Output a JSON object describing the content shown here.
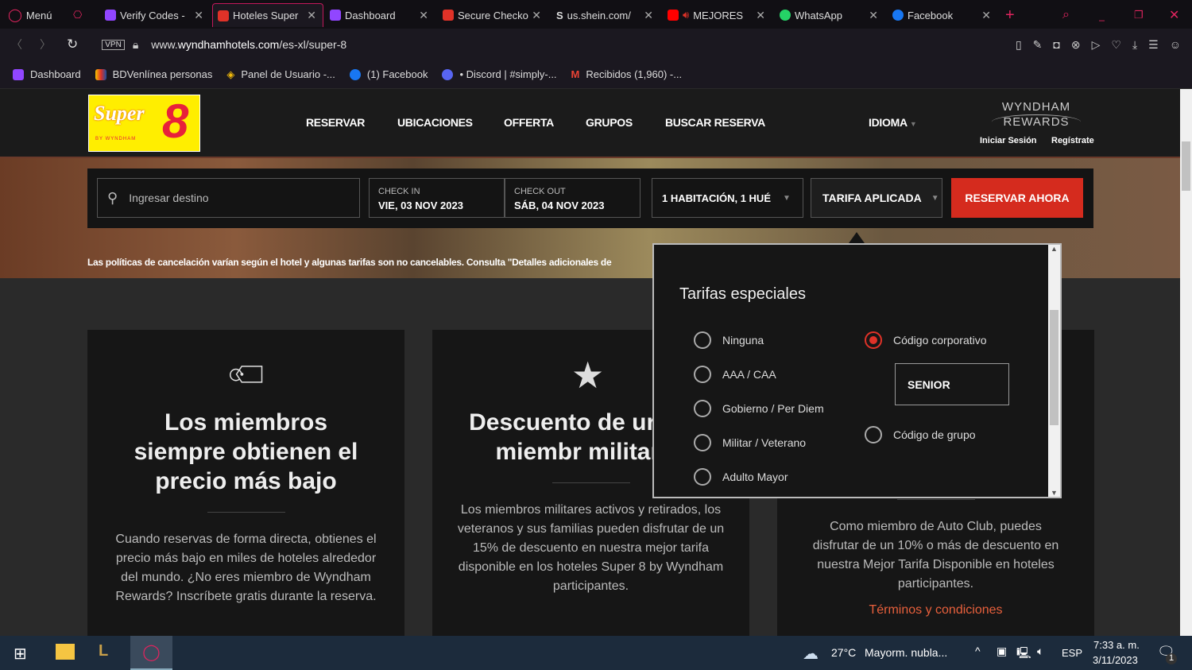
{
  "browser": {
    "menu_label": "Menú",
    "tabs": [
      {
        "label": "Verify Codes -",
        "icon": "twitch-icon"
      },
      {
        "label": "Hoteles Super",
        "icon": "super8-icon",
        "active": true
      },
      {
        "label": "Dashboard",
        "icon": "twitch-icon"
      },
      {
        "label": "Secure Checko",
        "icon": "checkout-icon"
      },
      {
        "label": "us.shein.com/",
        "icon": "shein-icon"
      },
      {
        "label": "MEJORES",
        "icon": "youtube-icon"
      },
      {
        "label": "WhatsApp",
        "icon": "whatsapp-icon"
      },
      {
        "label": "Facebook",
        "icon": "facebook-icon"
      }
    ],
    "vpn_label": "VPN",
    "url_prefix": "www.",
    "url_domain": "wyndhamhotels.com",
    "url_path": "/es-xl/super-8",
    "bookmarks": [
      {
        "label": "Dashboard",
        "icon": "twitch-icon"
      },
      {
        "label": "BDVenlínea personas",
        "icon": "bdv-icon"
      },
      {
        "label": "Panel de Usuario -...",
        "icon": "binance-icon"
      },
      {
        "label": "(1) Facebook",
        "icon": "facebook-icon"
      },
      {
        "label": "• Discord | #simply-...",
        "icon": "discord-icon"
      },
      {
        "label": "Recibidos (1,960) -...",
        "icon": "gmail-icon"
      }
    ]
  },
  "site": {
    "logo_text": "Super 8",
    "logo_sub": "BY WYNDHAM",
    "nav": [
      "RESERVAR",
      "UBICACIONES",
      "OFFERTA",
      "GRUPOS",
      "BUSCAR RESERVA"
    ],
    "language": "IDIOMA",
    "rewards_line1": "WYNDHAM",
    "rewards_line2": "REWARDS",
    "sign_in": "Iniciar Sesión",
    "register": "Regístrate",
    "booking": {
      "destination_placeholder": "Ingresar destino",
      "checkin_label": "CHECK IN",
      "checkin_value": "VIE, 03 NOV 2023",
      "checkout_label": "CHECK OUT",
      "checkout_value": "SÁB, 04 NOV 2023",
      "rooms": "1 HABITACIÓN, 1 HUÉ",
      "rate": "TARIFA APLICADA",
      "book_now": "RESERVAR AHORA"
    },
    "cancel_notice": "Las políticas de cancelación varían según el hotel y algunas tarifas son no cancelables. Consulta \"Detalles adicionales de",
    "rates_popup": {
      "title": "Tarifas especiales",
      "options_left": [
        "Ninguna",
        "AAA / CAA",
        "Gobierno / Per Diem",
        "Militar / Veterano",
        "Adulto Mayor"
      ],
      "corporate": "Código corporativo",
      "corporate_code": "SENIOR",
      "group": "Código de grupo",
      "selected": "Código corporativo"
    },
    "cards": [
      {
        "title": "Los miembros siempre obtienen el precio más bajo",
        "body": "Cuando reservas de forma directa, obtienes el precio más bajo en miles de hoteles alrededor del mundo. ¿No eres miembro de Wyndham Rewards? Inscríbete gratis durante la reserva.",
        "icon": "tag-icon"
      },
      {
        "title": "Descuento de ur para miembr militares",
        "body": "Los miembros militares activos y retirados, los veteranos y sus familias pueden disfrutar de un 15% de descuento en nuestra mejor tarifa disponible en los hoteles Super 8 by Wyndham participantes.",
        "icon": "star-icon"
      },
      {
        "body": "Como miembro de Auto Club, puedes disfrutar de un 10% o más de descuento en nuestra Mejor Tarifa Disponible en hoteles participantes.",
        "link": "Términos y condiciones"
      }
    ],
    "colors": {
      "accent": "#d52b1e",
      "link": "#e8603c",
      "logo_bg": "#ffee00"
    }
  },
  "taskbar": {
    "weather_temp": "27°C",
    "weather_text": "Mayorm. nubla...",
    "lang": "ESP",
    "time": "7:33 a. m.",
    "date": "3/11/2023",
    "notif_count": "1"
  }
}
